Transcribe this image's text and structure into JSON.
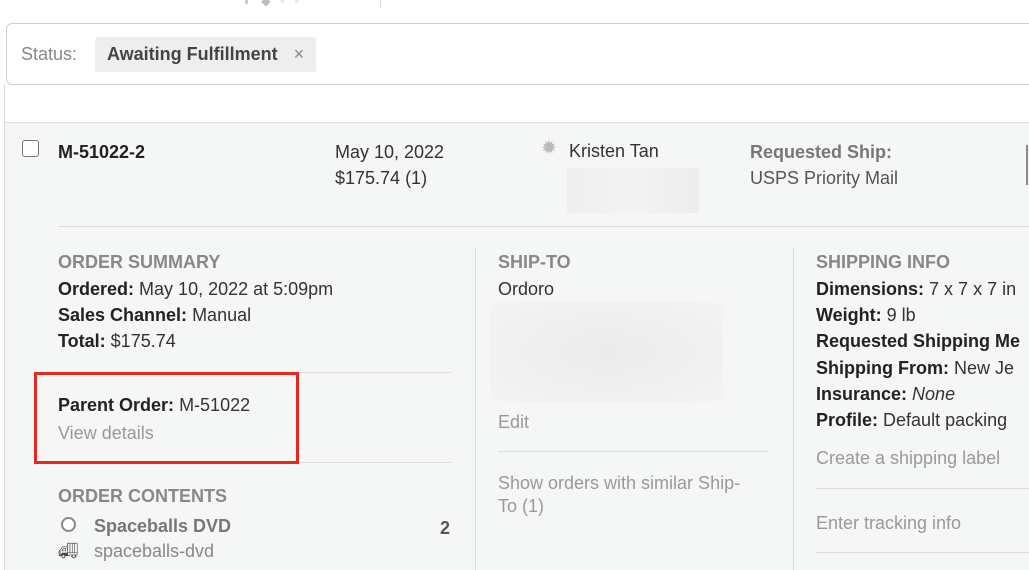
{
  "filter": {
    "label": "Status:",
    "chip_text": "Awaiting Fulfillment",
    "chip_close": "×"
  },
  "order": {
    "number": "M-51022-2",
    "date": "May 10, 2022",
    "total_count": "$175.74 (1)",
    "customer": "Kristen Tan",
    "requested_ship_label": "Requested Ship:",
    "requested_ship_value": "USPS Priority Mail"
  },
  "summary": {
    "title": "ORDER SUMMARY",
    "ordered_label": "Ordered:",
    "ordered_value": "May 10, 2022 at 5:09pm",
    "channel_label": "Sales Channel:",
    "channel_value": "Manual",
    "total_label": "Total:",
    "total_value": "$175.74",
    "parent_label": "Parent Order:",
    "parent_value": "M-51022",
    "view_details": "View details"
  },
  "contents": {
    "title": "ORDER CONTENTS",
    "items": [
      {
        "name": "Spaceballs DVD",
        "sku": "spaceballs-dvd",
        "qty": "2"
      }
    ]
  },
  "ship_to": {
    "title": "SHIP-TO",
    "name": "Ordoro",
    "edit": "Edit",
    "similar": "Show orders with similar Ship-",
    "similar_2": "To (1)"
  },
  "shipping_info": {
    "title": "SHIPPING INFO",
    "dimensions_label": "Dimensions:",
    "dimensions_value": "7 x 7 x 7 in",
    "weight_label": "Weight:",
    "weight_value": "9 lb",
    "requested_label": "Requested Shipping Me",
    "from_label": "Shipping From:",
    "from_value": "New Je",
    "insurance_label": "Insurance:",
    "insurance_value": "None",
    "profile_label": "Profile:",
    "profile_value": "Default packing",
    "create_label": "Create a shipping label",
    "tracking": "Enter tracking info"
  },
  "colors": {
    "highlight": "#e8281e",
    "panel_bg": "#f5f6f6"
  }
}
